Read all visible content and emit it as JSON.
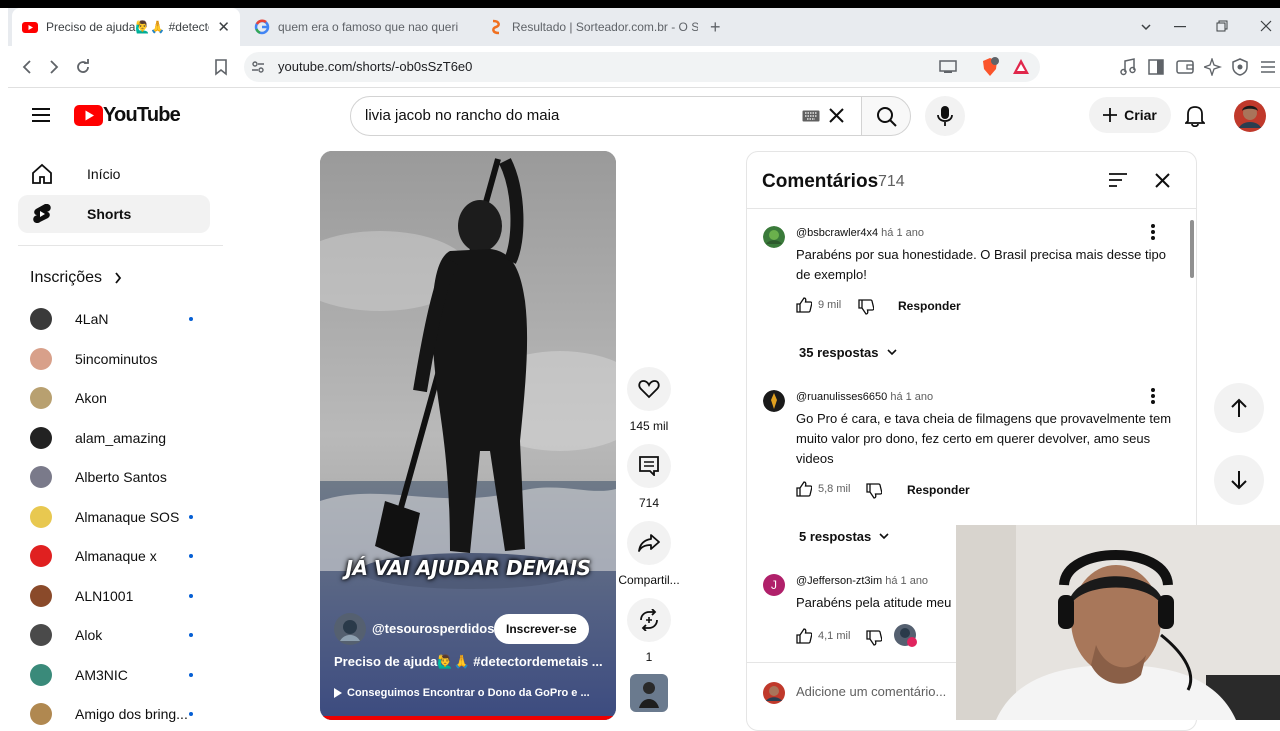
{
  "browser": {
    "tabs": [
      {
        "title": "Preciso de ajuda🙋‍♂️🙏 #detector...",
        "active": true
      },
      {
        "title": "quem era o famoso que nao queria s",
        "active": false
      },
      {
        "title": "Resultado | Sorteador.com.br - O Site",
        "active": false
      }
    ],
    "url": "youtube.com/shorts/-ob0sSzT6e0"
  },
  "yt": {
    "logo_text": "YouTube",
    "search_value": "livia jacob no rancho do maia",
    "create_label": "Criar"
  },
  "sidebar": {
    "items": [
      {
        "label": "Início",
        "icon": "home-icon"
      },
      {
        "label": "Shorts",
        "icon": "shorts-icon",
        "selected": true
      }
    ],
    "subs_title": "Inscrições",
    "subscriptions": [
      {
        "name": "4LaN",
        "new": true,
        "color": "#3a3a3a"
      },
      {
        "name": "5incominutos",
        "new": false,
        "color": "#d8a08a"
      },
      {
        "name": "Akon",
        "new": false,
        "color": "#b8a070"
      },
      {
        "name": "alam_amazing",
        "new": false,
        "color": "#222222"
      },
      {
        "name": "Alberto Santos",
        "new": false,
        "color": "#7a7a8a"
      },
      {
        "name": "Almanaque SOS",
        "new": true,
        "color": "#e8c850"
      },
      {
        "name": "Almanaque x",
        "new": true,
        "color": "#e02020"
      },
      {
        "name": "ALN1001",
        "new": true,
        "color": "#8a4a2a"
      },
      {
        "name": "Alok",
        "new": true,
        "color": "#4a4a4a"
      },
      {
        "name": "AM3NIC",
        "new": true,
        "color": "#3a8a7a"
      },
      {
        "name": "Amigo dos bring...",
        "new": true,
        "color": "#b08850"
      }
    ]
  },
  "video": {
    "caption": "JÁ VAI AJUDAR DEMAIS",
    "channel": "@tesourosperdidos",
    "subscribe_label": "Inscrever-se",
    "title": "Preciso de ajuda🙋‍♂️🙏 #detectordemetais ...",
    "pill": "Conseguimos Encontrar o Dono da GoPro e ..."
  },
  "actions": {
    "likes": "145 mil",
    "comments": "714",
    "share": "Compartil...",
    "remix": "1"
  },
  "comments": {
    "title": "Comentários",
    "count": "714",
    "add_placeholder": "Adicione um comentário...",
    "reply_label": "Responder",
    "items": [
      {
        "author": "@bsbcrawler4x4",
        "time": "há 1 ano",
        "text": "Parabéns por sua honestidade. O Brasil precisa mais desse tipo de exemplo!",
        "likes": "9 mil",
        "replies": "35 respostas",
        "avatar_color": "#3a7a3a"
      },
      {
        "author": "@ruanulisses6650",
        "time": "há 1 ano",
        "text": "Go Pro é cara, e tava cheia de filmagens que provavelmente tem muito valor pro dono, fez certo em querer devolver, amo seus videos",
        "likes": "5,8 mil",
        "replies": "5 respostas",
        "avatar_color": "#222222"
      },
      {
        "author": "@Jefferson-zt3im",
        "time": "há 1 ano",
        "text": "Parabéns pela atitude meu",
        "likes": "4,1 mil",
        "avatar_letter": "J",
        "avatar_color": "#b0206a"
      }
    ]
  },
  "colors": {
    "brand_red": "#ff0000",
    "link_blue": "#065fd4"
  }
}
